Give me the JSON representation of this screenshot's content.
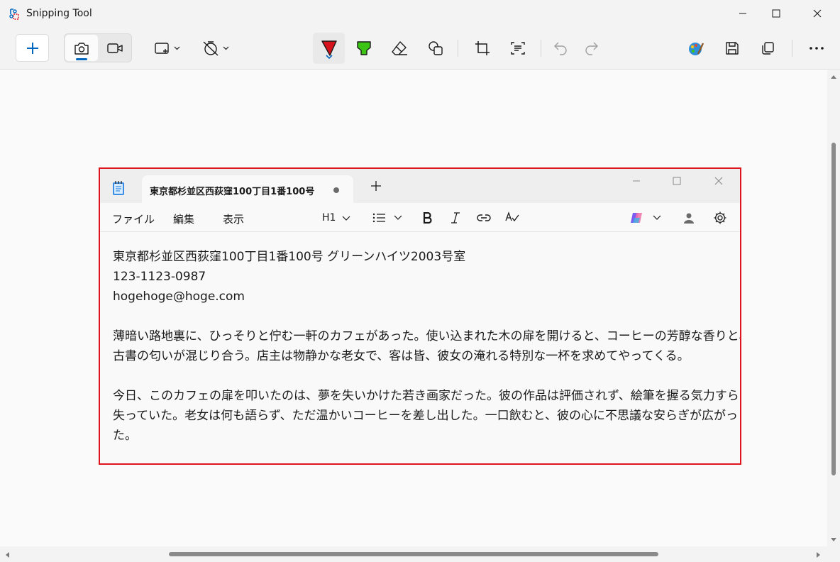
{
  "window": {
    "title": "Snipping Tool"
  },
  "toolbar": {
    "new_icon": "plus-icon",
    "modes": [
      "camera-icon",
      "video-icon"
    ],
    "tools": [
      "rectangle-snip-icon",
      "timer-off-icon",
      "ballpoint-pen-icon",
      "highlighter-icon",
      "eraser-icon",
      "shapes-icon",
      "crop-icon",
      "text-actions-icon",
      "undo-icon",
      "redo-icon",
      "paint-icon",
      "save-icon",
      "copy-icon",
      "more-icon"
    ],
    "pen_color": "#d6131c",
    "highlighter_color": "#3cc414"
  },
  "snip": {
    "border_color": "#e0141e",
    "tab_title": "東京都杉並区西荻窪100丁目1番100号",
    "menu": {
      "file": "ファイル",
      "edit": "編集",
      "view": "表示"
    },
    "heading_label": "H1",
    "content": {
      "line1": "東京都杉並区西荻窪100丁目1番100号 グリーンハイツ2003号室",
      "line2": "123-1123-0987",
      "line3": "hogehoge@hoge.com",
      "para1_line1": "薄暗い路地裏に、ひっそりと佇む一軒のカフェがあった。使い込まれた木の扉を開けると、コーヒーの芳醇な香りと、",
      "para1_line2": "古書の匂いが混じり合う。店主は物静かな老女で、客は皆、彼女の淹れる特別な一杯を求めてやってくる。",
      "para2_line1": "今日、このカフェの扉を叩いたのは、夢を失いかけた若き画家だった。彼の作品は評価されず、絵筆を握る気力すら",
      "para2_line2": "失っていた。老女は何も語らず、ただ温かいコーヒーを差し出した。一口飲むと、彼の心に不思議な安らぎが広がっ",
      "para2_line3": "た。"
    }
  }
}
